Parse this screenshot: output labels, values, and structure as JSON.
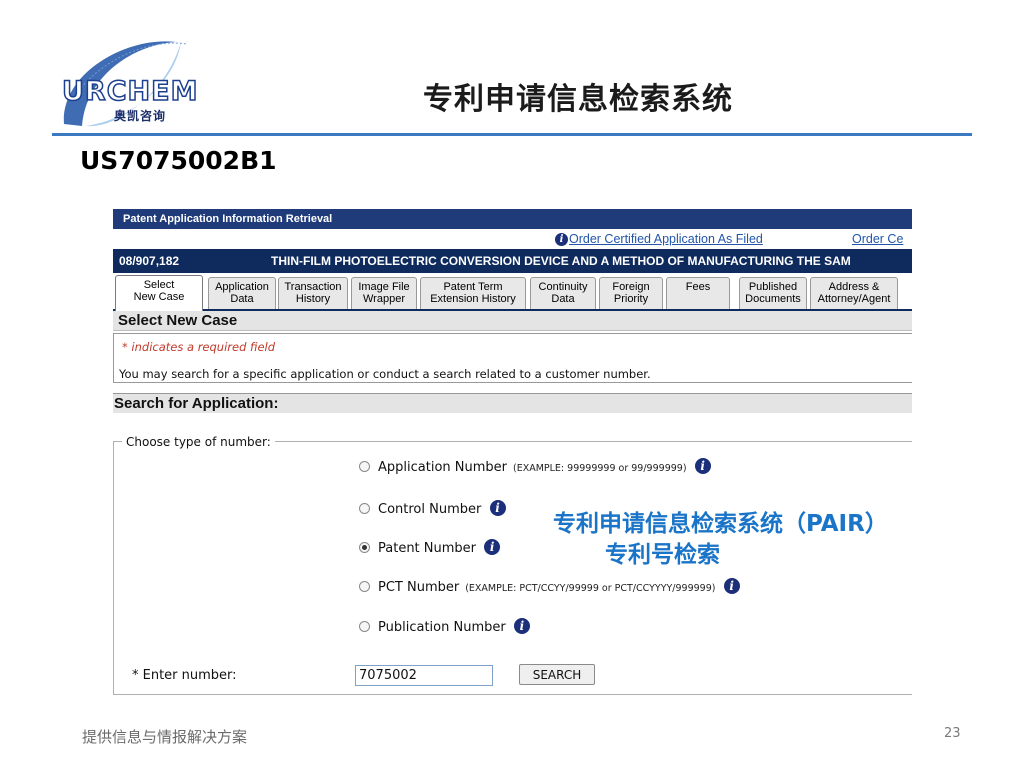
{
  "slide": {
    "logo_text": "URCHEM",
    "logo_cn": "奥凯咨询",
    "title": "专利申请信息检索系统",
    "patent_number": "US7075002B1",
    "footer": "提供信息与情报解决方案",
    "page": "23"
  },
  "pair": {
    "header": "Patent Application Information Retrieval",
    "order_link_1": "Order Certified Application As Filed",
    "order_link_2": "Order Ce",
    "application_number": "08/907,182",
    "application_title": "THIN-FILM PHOTOELECTRIC CONVERSION DEVICE AND A METHOD OF MANUFACTURING THE SAM",
    "tabs": [
      "Select\nNew Case",
      "Application\nData",
      "Transaction\nHistory",
      "Image File\nWrapper",
      "Patent Term\nExtension History",
      "Continuity\nData",
      "Foreign\nPriority",
      "Fees",
      "Published\nDocuments",
      "Address &\nAttorney/Agent"
    ],
    "section_title": "Select New Case",
    "required_note": "* indicates a required field",
    "search_description": "You may search for a specific application or conduct a search related to a customer number.",
    "search_title": "Search for Application:",
    "legend": "Choose type of number:",
    "options": [
      {
        "label": "Application Number",
        "example": "(EXAMPLE: 99999999 or 99/999999)",
        "selected": false
      },
      {
        "label": "Control Number",
        "example": "",
        "selected": false
      },
      {
        "label": "Patent Number",
        "example": "",
        "selected": true
      },
      {
        "label": "PCT Number",
        "example": "(EXAMPLE: PCT/CCYY/99999 or PCT/CCYYYY/999999)",
        "selected": false
      },
      {
        "label": "Publication Number",
        "example": "",
        "selected": false
      }
    ],
    "enter_label": "* Enter number:",
    "number_value": "7075002",
    "search_button": "SEARCH"
  },
  "annotation": {
    "line1": "专利申请信息检索系统（PAIR）",
    "line2": "专利号检索"
  },
  "icons": {
    "info": "info-icon"
  },
  "colors": {
    "pair_header": "#1f3b7a",
    "case_bar": "#0f2b5e",
    "annotation": "#1a74c7",
    "title_rule": "#3b79c0"
  }
}
